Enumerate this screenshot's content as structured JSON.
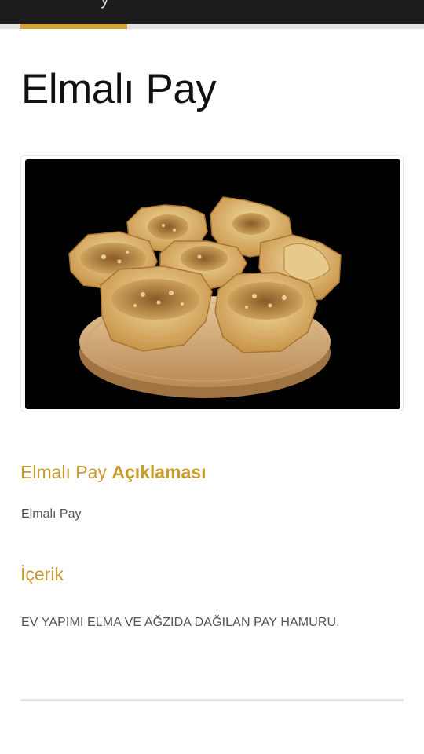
{
  "topbar": {
    "cut_text": "y"
  },
  "progress": {
    "value_percent": 30
  },
  "page": {
    "title": "Elmalı Pay"
  },
  "image": {
    "description": ""
  },
  "description_section": {
    "heading_normal": "Elmalı Pay ",
    "heading_bold": "Açıklaması",
    "text": "Elmalı Pay"
  },
  "ingredients_section": {
    "heading": "İçerik",
    "text": "EV YAPIMI ELMA VE AĞZIDA DAĞILAN PAY HAMURU."
  },
  "bottom": {
    "cut_text": ""
  },
  "colors": {
    "accent": "#c99a2e",
    "topbar": "#1c1c1c"
  }
}
